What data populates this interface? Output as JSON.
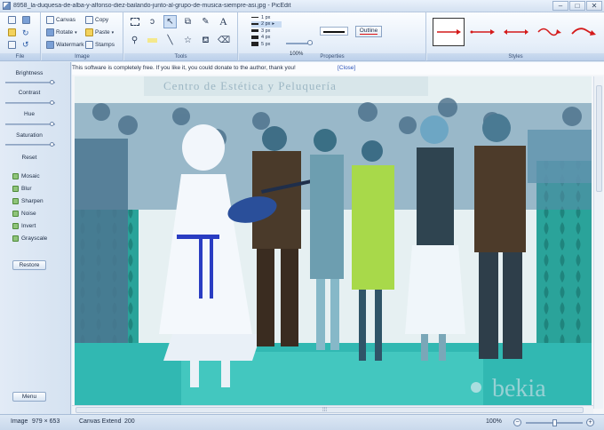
{
  "window": {
    "title": "8958_la-duquesa-de-alba-y-alfonso-diez-bailando-junto-al-grupo-de-musica-siempre-asi.jpg - PicEdit",
    "controls": [
      "minimize",
      "maximize",
      "close"
    ]
  },
  "ribbon": {
    "file": {
      "title": "File"
    },
    "image": {
      "title": "Image",
      "canvas": "Canvas",
      "rotate": "Rotate",
      "watermark": "Watermark",
      "copy": "Copy",
      "paste": "Paste",
      "stamps": "Stamps"
    },
    "tools": {
      "title": "Tools"
    },
    "properties": {
      "title": "Properties",
      "widths": [
        "1 px",
        "2 px",
        "3 px",
        "4 px",
        "5 px"
      ],
      "selected_width": "2 px",
      "opacity": "100%",
      "outline_label": "Outline"
    },
    "styles": {
      "title": "Styles"
    }
  },
  "left_panel": {
    "brightness": "Brightness",
    "contrast": "Contrast",
    "hue": "Hue",
    "saturation": "Saturation",
    "reset": "Reset",
    "effects": [
      "Mosaic",
      "Blur",
      "Sharpen",
      "Noise",
      "Invert",
      "Grayscale"
    ],
    "restore": "Restore",
    "menu": "Menu"
  },
  "notice": {
    "message": "This software is completely free. If you like it, you could donate to the author, thank you!",
    "close": "[Close]"
  },
  "photo": {
    "banner_text": "Centro de Estética y Peluquería",
    "watermark_text": "bekia"
  },
  "status": {
    "image_label": "Image",
    "image_size": "979 × 653",
    "canvas_extend_label": "Canvas Extend",
    "canvas_extend_value": "200",
    "zoom": "100%"
  },
  "colors": {
    "accent_red": "#d41a1a",
    "ribbon_blue": "#bcd0ea",
    "dress_green": "#a8d94a",
    "link_blue": "#2a52b8"
  }
}
